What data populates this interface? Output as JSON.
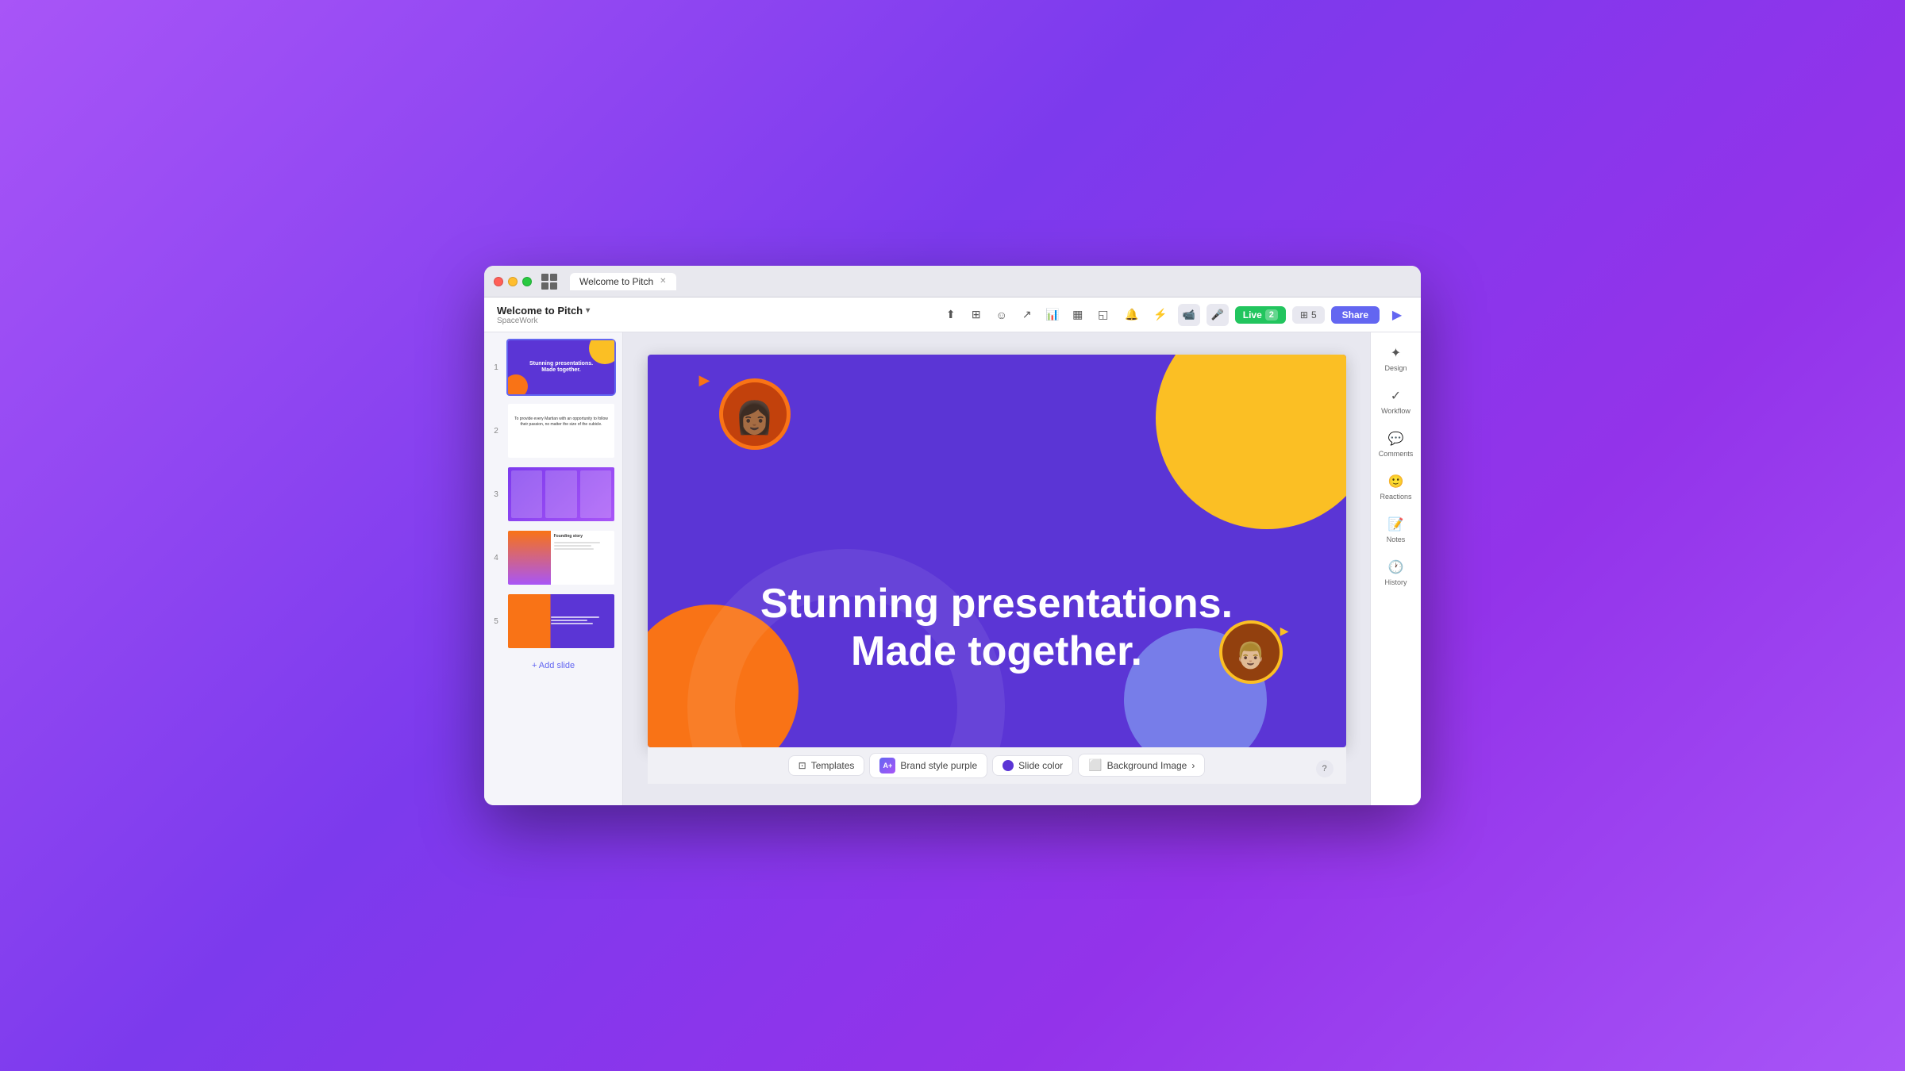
{
  "window": {
    "title": "Welcome to Pitch",
    "workspace": "SpaceWork"
  },
  "tabs": [
    {
      "label": "Welcome to Pitch",
      "active": true
    }
  ],
  "toolbar": {
    "presentation_title": "Welcome to Pitch",
    "workspace_name": "SpaceWork",
    "live_label": "Live",
    "live_count": "2",
    "slides_count": "5",
    "share_label": "Share"
  },
  "slide_panel": {
    "slides": [
      {
        "num": "1",
        "active": true
      },
      {
        "num": "2",
        "active": false
      },
      {
        "num": "3",
        "active": false
      },
      {
        "num": "4",
        "active": false
      },
      {
        "num": "5",
        "active": false
      }
    ],
    "add_slide_label": "+ Add slide"
  },
  "main_slide": {
    "line1": "Stunning presentations.",
    "line2": "Made together."
  },
  "bottom_toolbar": {
    "templates_label": "Templates",
    "brand_style_label": "Brand style purple",
    "slide_color_label": "Slide color",
    "background_image_label": "Background Image"
  },
  "right_sidebar": {
    "tools": [
      {
        "name": "design",
        "label": "Design",
        "icon": "✦"
      },
      {
        "name": "workflow",
        "label": "Workflow",
        "icon": "✓"
      },
      {
        "name": "comments",
        "label": "Comments",
        "icon": "💬"
      },
      {
        "name": "reactions",
        "label": "Reactions",
        "icon": "😊"
      },
      {
        "name": "notes",
        "label": "Notes",
        "icon": "📝"
      },
      {
        "name": "history",
        "label": "History",
        "icon": "🕐"
      }
    ]
  },
  "icons": {
    "upload": "⬆",
    "layout": "⊞",
    "emoji": "☺",
    "link": "⌁",
    "chart": "📊",
    "table": "▦",
    "embed": "◱",
    "bell": "🔔",
    "lightning": "⚡",
    "video": "📹",
    "mic": "🎤",
    "play": "▶",
    "chevron_down": "▾"
  }
}
